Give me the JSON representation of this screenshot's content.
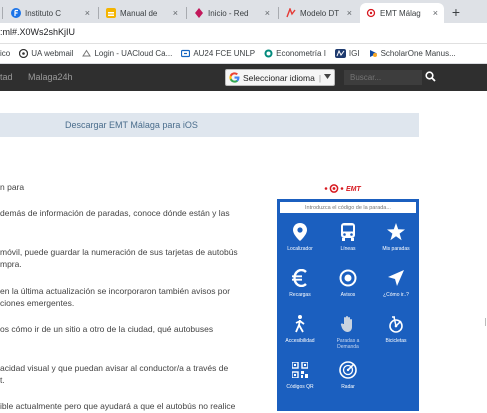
{
  "browser": {
    "tabs": [
      {
        "label": "Instituto C",
        "fav_color": "#1a73e8"
      },
      {
        "label": "Manual de",
        "fav_color": "#f4b400"
      },
      {
        "label": "Inicio - Red",
        "fav_color": "#c2185b"
      },
      {
        "label": "Modelo DT",
        "fav_color": "#e53935"
      },
      {
        "label": "EMT Málag",
        "fav_color": "#d71920"
      }
    ],
    "close_glyph": "×",
    "new_tab_glyph": "+",
    "address": ":ml#.X0Ws2shKjIU"
  },
  "bookmarks": [
    {
      "label": "ico",
      "color": ""
    },
    {
      "label": "UA webmail",
      "color": "#333333"
    },
    {
      "label": "Login - UACloud Ca...",
      "color": "#777777"
    },
    {
      "label": "AU24 FCE UNLP",
      "color": "#1565c0"
    },
    {
      "label": "Econometría I",
      "color": "#00897b"
    },
    {
      "label": "IGI",
      "color": "#1e3a6e"
    },
    {
      "label": "ScholarOne Manus...",
      "color": "#0d47a1"
    }
  ],
  "site_header": {
    "nav_left": "tad",
    "nav_malaga": "Malaga24h",
    "language_label": "Seleccionar idioma",
    "search_placeholder": "Buscar..."
  },
  "download_bar": {
    "text": "Descargar EMT Málaga para iOS"
  },
  "article_lines": [
    "n para",
    "demás de información de paradas, conoce dónde están y las",
    "móvil, puede guardar la numeración de sus tarjetas de autobús",
    "mpra.",
    "en la última actualización se incorporaron también avisos por",
    "ciones emergentes.",
    "os cómo ir de un sitio a otro de la ciudad, qué autobuses",
    "acidad visual y que puedan avisar al conductor/a a través de",
    "t.",
    "ible actualmente pero que ayudará a que el autobús no realice"
  ],
  "app": {
    "logo_text": "EMT",
    "stop_placeholder": "Introduzca el código de la parada...",
    "tiles": [
      {
        "label": "Localizador",
        "icon": "location-pin-icon"
      },
      {
        "label": "Líneas",
        "icon": "bus-icon"
      },
      {
        "label": "Mis paradas",
        "icon": "star-icon"
      },
      {
        "label": "Recargas",
        "icon": "euro-icon"
      },
      {
        "label": "Avisos",
        "icon": "radio-target-icon"
      },
      {
        "label": "¿Cómo ir..?",
        "icon": "navigation-arrow-icon"
      },
      {
        "label": "Accesibilidad",
        "icon": "walking-person-icon"
      },
      {
        "label": "Paradas a Demanda",
        "icon": "hand-icon"
      },
      {
        "label": "Bicicletas",
        "icon": "bicycle-icon"
      },
      {
        "label": "Códigos QR",
        "icon": "qr-code-icon"
      },
      {
        "label": "Radar",
        "icon": "radar-icon"
      }
    ]
  }
}
